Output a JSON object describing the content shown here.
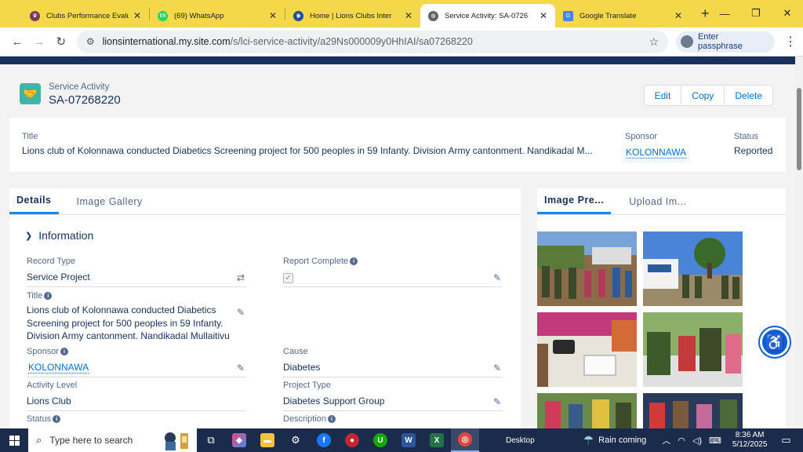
{
  "browser": {
    "tabs": [
      {
        "title": "Clubs Performance Evalu",
        "icon": "lions-club-icon",
        "color": "#7a3b5a"
      },
      {
        "title": "(69) WhatsApp",
        "icon": "whatsapp-icon",
        "color": "#25d366"
      },
      {
        "title": "Home | Lions Clubs Inter",
        "icon": "lions-icon",
        "color": "#1f4f9c"
      },
      {
        "title": "Service Activity: SA-0726",
        "icon": "globe-icon",
        "color": "#5f6368",
        "active": true
      },
      {
        "title": "Google Translate",
        "icon": "translate-icon",
        "color": "#4285f4"
      }
    ],
    "url_host": "lionsinternational.my.site.com",
    "url_path": "/s/lci-service-activity/a29Ns000009y0HhIAI/sa07268220",
    "profile_label": "Enter passphrase"
  },
  "record": {
    "type_label": "Service Activity",
    "name": "SA-07268220",
    "actions": [
      "Edit",
      "Copy",
      "Delete"
    ]
  },
  "highlights": {
    "title_label": "Title",
    "title_value": "Lions club of Kolonnawa conducted Diabetics Screening project for 500 peoples in 59 Infanty. Division Army cantonment. Nandikadal M...",
    "sponsor_label": "Sponsor",
    "sponsor_value": "KOLONNAWA",
    "status_label": "Status",
    "status_value": "Reported"
  },
  "details": {
    "tabs": [
      "Details",
      "Image Gallery"
    ],
    "section": "Information",
    "fields": {
      "record_type": {
        "label": "Record Type",
        "value": "Service Project"
      },
      "report_complete": {
        "label": "Report Complete"
      },
      "title": {
        "label": "Title",
        "value": "Lions club of Kolonnawa conducted Diabetics Screening project for 500 peoples in 59 Infanty. Division Army cantonment. Nandikadal Mullaitivu"
      },
      "sponsor": {
        "label": "Sponsor",
        "value": "KOLONNAWA"
      },
      "cause": {
        "label": "Cause",
        "value": "Diabetes"
      },
      "activity_level": {
        "label": "Activity Level",
        "value": "Lions Club"
      },
      "project_type": {
        "label": "Project Type",
        "value": "Diabetes Support Group"
      },
      "status": {
        "label": "Status"
      },
      "description": {
        "label": "Description"
      }
    }
  },
  "image_panel": {
    "tabs": [
      "Image Pre...",
      "Upload Im..."
    ]
  },
  "taskbar": {
    "search_placeholder": "Type here to search",
    "desktop_label": "Desktop",
    "weather": "Rain coming",
    "time": "8:36 AM",
    "date": "5/12/2025"
  }
}
